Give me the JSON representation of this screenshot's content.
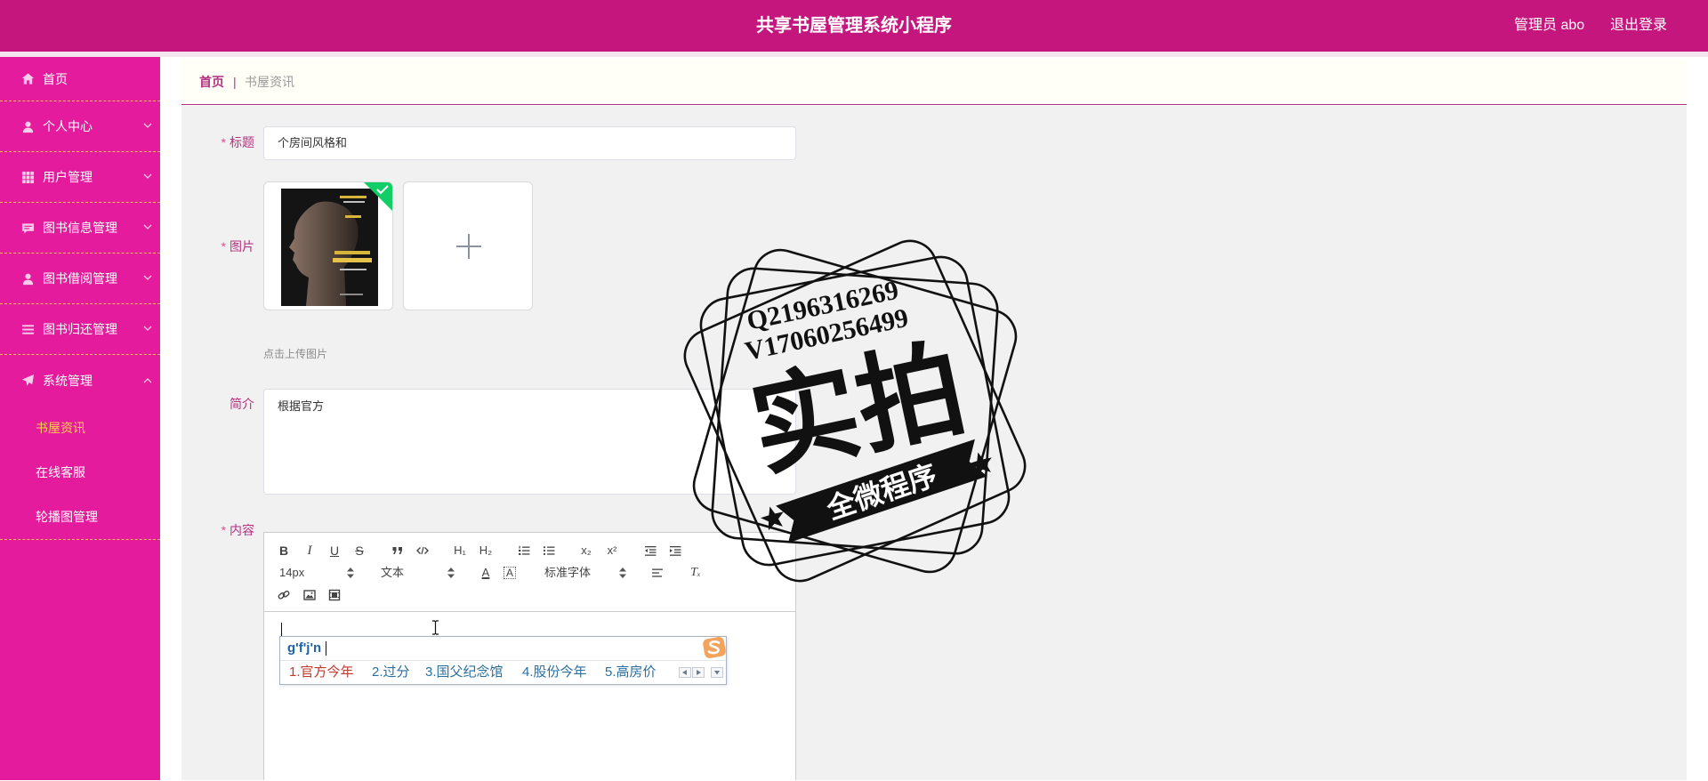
{
  "header": {
    "title": "共享书屋管理系统小程序",
    "user": "管理员 abo",
    "logout": "退出登录"
  },
  "sidebar": {
    "items": [
      {
        "label": "首页",
        "icon": "home-icon"
      },
      {
        "label": "个人中心",
        "icon": "user-icon"
      },
      {
        "label": "用户管理",
        "icon": "grid-icon"
      },
      {
        "label": "图书信息管理",
        "icon": "message-icon"
      },
      {
        "label": "图书借阅管理",
        "icon": "user-icon"
      },
      {
        "label": "图书归还管理",
        "icon": "list-icon"
      },
      {
        "label": "系统管理",
        "icon": "paper-plane-icon",
        "expanded": true
      }
    ],
    "submenu": [
      {
        "label": "书屋资讯",
        "active": true
      },
      {
        "label": "在线客服"
      },
      {
        "label": "轮播图管理"
      }
    ]
  },
  "breadcrumb": {
    "home": "首页",
    "separator": "|",
    "current": "书屋资讯"
  },
  "form": {
    "title": {
      "required": "*",
      "label": "标题",
      "value": "个房间风格和"
    },
    "image": {
      "required": "*",
      "label": "图片",
      "hint": "点击上传图片"
    },
    "intro": {
      "label": "简介",
      "value": "根据官方"
    },
    "content": {
      "required": "*",
      "label": "内容"
    }
  },
  "editor": {
    "toolbar": {
      "bold": "B",
      "italic": "I",
      "underline": "U",
      "strike": "S",
      "heading1": "H₁",
      "heading2": "H₂",
      "subscript": "x₂",
      "superscript": "x²",
      "font_size": "14px",
      "text_type": "文本",
      "font_color": "A",
      "background_color": "A",
      "font_family": "标准字体",
      "clear_format": "Tₓ"
    },
    "ime": {
      "composition": "g'f'j'n",
      "candidates": [
        "1.官方今年",
        "2.过分",
        "3.国父纪念馆",
        "4.股份今年",
        "5.高房价"
      ]
    }
  },
  "watermark": {
    "qq": "Q2196316269",
    "wechat": "V17060256499",
    "stamp_text": "实拍",
    "banner": "全微程序"
  },
  "colors": {
    "header": "#c5167e",
    "sidebar": "#e31b9c",
    "active_menu": "#ffd04b",
    "accent": "#b3317f",
    "success": "#13ce66"
  }
}
